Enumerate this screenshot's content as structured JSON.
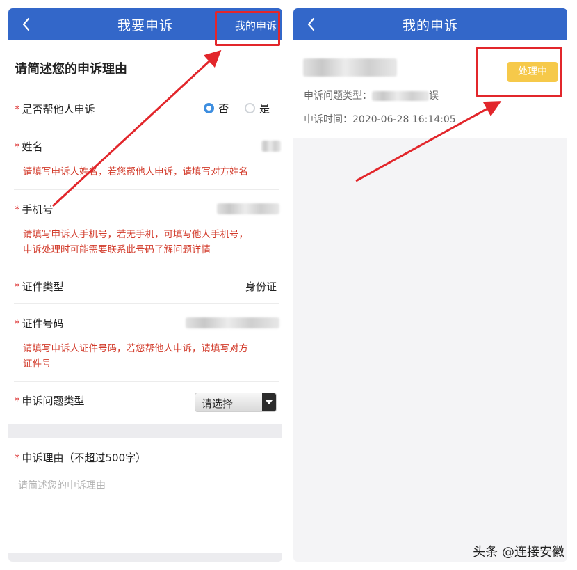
{
  "left": {
    "header": {
      "title": "我要申诉",
      "action_label": "我的申诉"
    },
    "section_title": "请简述您的申诉理由",
    "help_other": {
      "label": "是否帮他人申诉",
      "options": [
        "否",
        "是"
      ],
      "selected": "否"
    },
    "name": {
      "label": "姓名",
      "hint": "请填写申诉人姓名，若您帮他人申诉，请填写对方姓名"
    },
    "phone": {
      "label": "手机号",
      "hint_line1": "请填写申诉人手机号，若无手机，可填写他人手机号，",
      "hint_line2": "申诉处理时可能需要联系此号码了解问题详情"
    },
    "id_type": {
      "label": "证件类型",
      "value": "身份证"
    },
    "id_number": {
      "label": "证件号码",
      "hint_line1": "请填写申诉人证件号码，若您帮他人申诉，请填写对方",
      "hint_line2": "证件号"
    },
    "problem_type": {
      "label": "申诉问题类型",
      "select_value": "请选择"
    },
    "reason": {
      "label": "申诉理由（不超过500字）",
      "placeholder": "请简述您的申诉理由"
    },
    "required_mark": "*"
  },
  "right": {
    "header": {
      "title": "我的申诉"
    },
    "item": {
      "type_label": "申诉问题类型：",
      "type_value_tail": "误",
      "time_label": "申诉时间：",
      "time_value": "2020-06-28 16:14:05",
      "status": "处理中"
    }
  },
  "watermark": "头条 @连接安徽",
  "colors": {
    "header_blue": "#3367c9",
    "hint_red": "#d23a2a",
    "status_yellow": "#f6c94a",
    "annotation_red": "#e2262b"
  },
  "icons": {
    "back": "chevron-left-icon",
    "select_arrow": "caret-down-icon"
  }
}
